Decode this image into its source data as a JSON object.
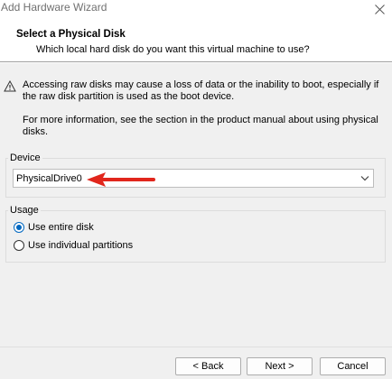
{
  "window": {
    "title": "Add Hardware Wizard",
    "close_icon": "close-icon"
  },
  "header": {
    "title": "Select a Physical Disk",
    "subtitle": "Which local hard disk do you want this virtual machine to use?"
  },
  "warning": {
    "icon": "warning-icon",
    "text": "Accessing raw disks may cause a loss of data or the inability to boot, especially if the raw disk partition is used as the boot device.",
    "info": "For more information, see the section in the product manual about using physical disks."
  },
  "device": {
    "group_label": "Device",
    "selected": "PhysicalDrive0",
    "chevron_icon": "chevron-down-icon"
  },
  "annotation": {
    "arrow_color": "#e1261c"
  },
  "usage": {
    "group_label": "Usage",
    "options": [
      {
        "label": "Use entire disk",
        "checked": true
      },
      {
        "label": "Use individual partitions",
        "checked": false
      }
    ]
  },
  "buttons": {
    "back": "< Back",
    "next": "Next >",
    "cancel": "Cancel"
  },
  "colors": {
    "accent": "#0067c0",
    "header_bg": "#ffffff",
    "body_bg": "#f0f0f0"
  }
}
